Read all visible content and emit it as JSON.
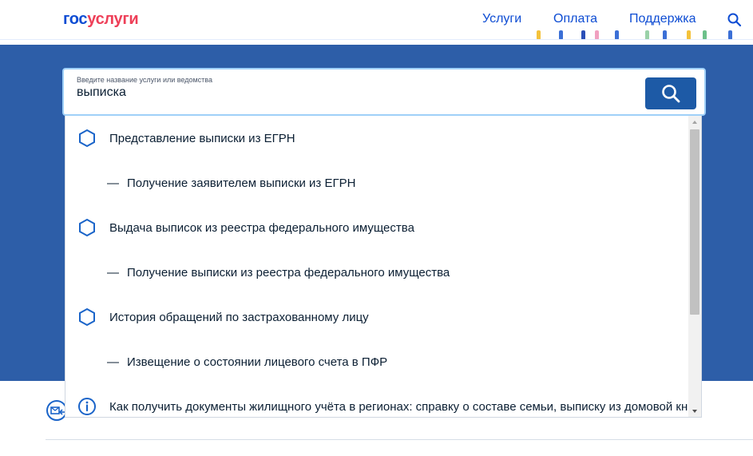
{
  "header": {
    "logo_part1": "гос",
    "logo_part2": "услуги",
    "nav": [
      "Услуги",
      "Оплата",
      "Поддержка"
    ],
    "search_icon": "search-icon"
  },
  "search": {
    "label": "Введите название услуги или ведомства",
    "value": "выписка",
    "button_icon": "search-icon"
  },
  "suggestions": [
    {
      "type": "service",
      "icon": "hexagon-icon",
      "text": "Представление выписки из ЕГРН"
    },
    {
      "type": "child",
      "dash": "—",
      "text": "Получение заявителем выписки из ЕГРН"
    },
    {
      "type": "service",
      "icon": "hexagon-icon",
      "text": "Выдача выписок из реестра федерального имущества"
    },
    {
      "type": "child",
      "dash": "—",
      "text": "Получение выписки из реестра федерального имущества"
    },
    {
      "type": "service",
      "icon": "hexagon-icon",
      "text": "История обращений по застрахованному лицу"
    },
    {
      "type": "child",
      "dash": "—",
      "text": "Извещение о состоянии лицевого счета в ПФР"
    },
    {
      "type": "info",
      "icon": "info-icon",
      "text": "Как получить документы жилищного учёта в регионах: справку о составе семьи, выписку из домовой книги"
    }
  ],
  "colors": {
    "brand_blue": "#0d4cd3",
    "brand_red": "#ee3f58",
    "band": "#2d5ea8",
    "button": "#1d5aa6",
    "icon_stroke": "#1a64c9"
  }
}
